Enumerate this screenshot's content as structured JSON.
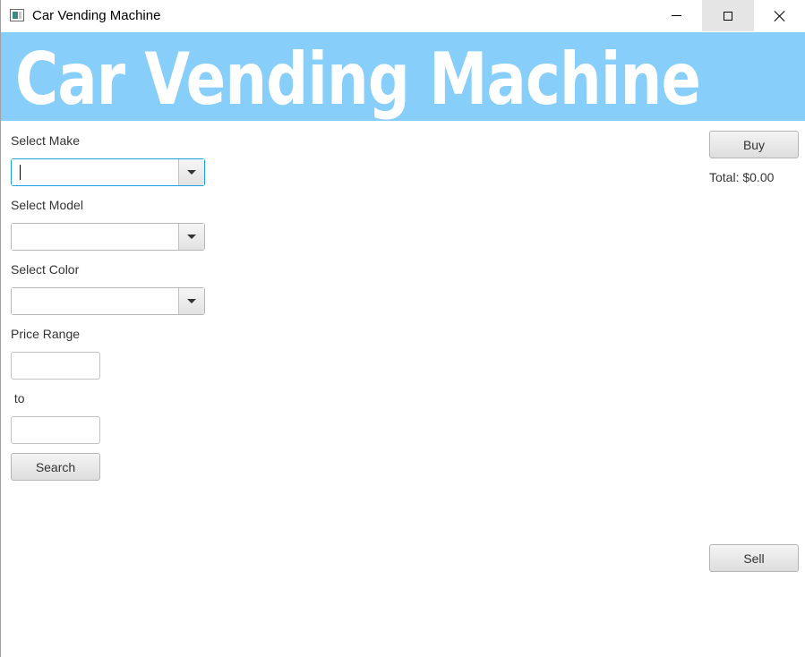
{
  "window": {
    "title": "Car Vending Machine",
    "controls": {
      "minimize_icon": "minimize-icon",
      "maximize_icon": "maximize-icon",
      "close_icon": "close-icon"
    }
  },
  "banner": {
    "title": "Car Vending Machine",
    "background_color": "#87cefa",
    "text_color": "#ffffff"
  },
  "form": {
    "make": {
      "label": "Select Make",
      "value": ""
    },
    "model": {
      "label": "Select Model",
      "value": ""
    },
    "color": {
      "label": "Select Color",
      "value": ""
    },
    "price_range": {
      "label": "Price Range",
      "min_value": "",
      "separator": " to",
      "max_value": ""
    },
    "search_button": "Search"
  },
  "actions": {
    "buy_button": "Buy",
    "total_label": "Total: $0.00",
    "sell_button": "Sell"
  }
}
